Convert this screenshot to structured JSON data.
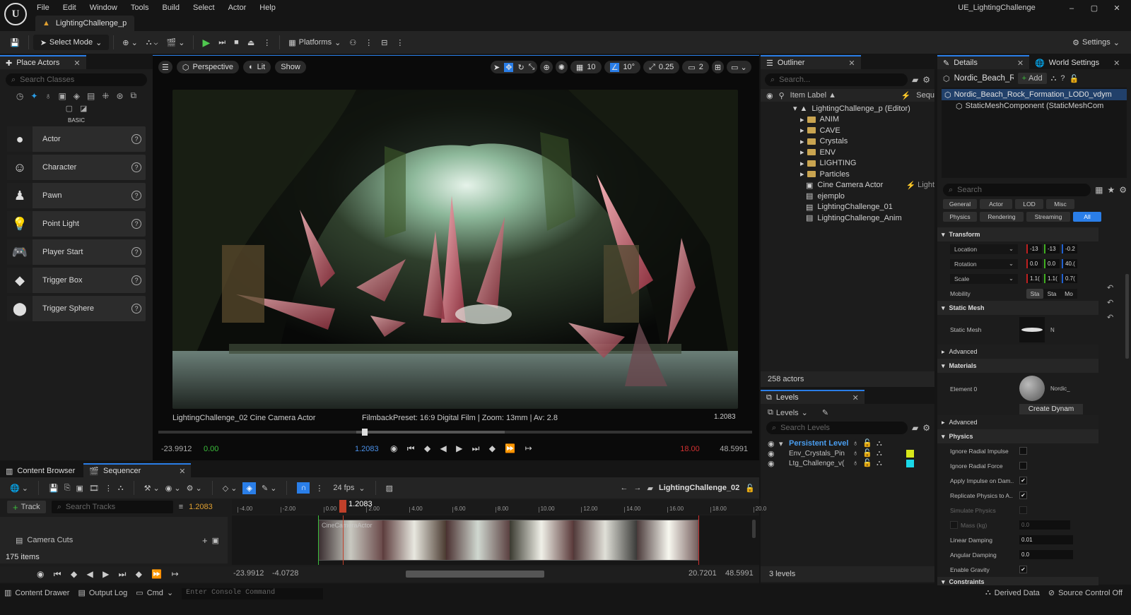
{
  "app": {
    "menus": [
      "File",
      "Edit",
      "Window",
      "Tools",
      "Build",
      "Select",
      "Actor",
      "Help"
    ],
    "level_tab": "LightingChallenge_p",
    "project_name": "UE_LightingChallenge",
    "window_controls": {
      "minimize": "–",
      "maximize": "▢",
      "close": "✕"
    }
  },
  "toolbar": {
    "select_mode": "Select Mode",
    "platforms": "Platforms",
    "settings": "Settings"
  },
  "place_actors": {
    "tab": "Place Actors",
    "search_placeholder": "Search Classes",
    "category": "BASIC",
    "items": [
      "Actor",
      "Character",
      "Pawn",
      "Point Light",
      "Player Start",
      "Trigger Box",
      "Trigger Sphere"
    ]
  },
  "viewport": {
    "perspective": "Perspective",
    "lit": "Lit",
    "show": "Show",
    "grid_snap": "10",
    "angle_snap": "10°",
    "scale_snap": "0.25",
    "camera_speed": "2",
    "camera_label": "LightingChallenge_02  Cine Camera Actor",
    "filmback": "FilmbackPreset: 16:9 Digital Film | Zoom: 13mm | Av: 2.8",
    "time_readout": "1.2083",
    "start_time": "-23.9912",
    "in_time": "0.00",
    "current_time": "1.2083",
    "out_time": "18.00",
    "end_time": "48.5991"
  },
  "outliner": {
    "tab": "Outliner",
    "search_placeholder": "Search...",
    "column_label": "Item Label ▲",
    "column_seq": "Sequ",
    "root": "LightingChallenge_p (Editor)",
    "folders": [
      "ANIM",
      "CAVE",
      "Crystals",
      "ENV",
      "LIGHTING",
      "Particles"
    ],
    "actors": [
      {
        "name": "Cine Camera Actor",
        "extra": "Light"
      },
      {
        "name": "ejemplo",
        "extra": ""
      },
      {
        "name": "LightingChallenge_01",
        "extra": ""
      },
      {
        "name": "LightingChallenge_Anim",
        "extra": ""
      }
    ],
    "count": "258 actors"
  },
  "levels": {
    "tab": "Levels",
    "dropdown": "Levels",
    "search_placeholder": "Search Levels",
    "items": [
      {
        "name": "Persistent Level",
        "color": ""
      },
      {
        "name": "Env_Crystals_Pin",
        "color": "#d8e81a"
      },
      {
        "name": "Ltg_Challenge_v(",
        "color": "#1ad8e8"
      }
    ],
    "count": "3 levels"
  },
  "details": {
    "tab": "Details",
    "world_tab": "World Settings",
    "actor_name": "Nordic_Beach_R",
    "add": "Add",
    "selected_actor": "Nordic_Beach_Rock_Formation_LOD0_vdym",
    "component": "StaticMeshComponent (StaticMeshCom",
    "search_placeholder": "Search",
    "filters_row1": [
      "General",
      "Actor",
      "LOD",
      "Misc"
    ],
    "filters_row2": [
      "Physics",
      "Rendering",
      "Streaming",
      "All"
    ],
    "transform_header": "Transform",
    "location": {
      "label": "Location",
      "values": [
        "-13",
        "-13",
        "-0.2"
      ]
    },
    "rotation": {
      "label": "Rotation",
      "values": [
        "0.0",
        "0.0",
        "40.("
      ]
    },
    "scale": {
      "label": "Scale",
      "values": [
        "1.1(",
        "1.1(",
        "0.7("
      ]
    },
    "mobility": {
      "label": "Mobility",
      "options": [
        "Sta",
        "Sta",
        "Mo"
      ]
    },
    "static_mesh_header": "Static Mesh",
    "static_mesh_label": "Static Mesh",
    "static_mesh_value": "N",
    "advanced": "Advanced",
    "materials_header": "Materials",
    "element0": "Element 0",
    "material_value": "Nordic_",
    "create_dynamic": "Create Dynam",
    "physics_header": "Physics",
    "physics_props": [
      {
        "label": "Ignore Radial Impulse",
        "checked": false
      },
      {
        "label": "Ignore Radial Force",
        "checked": false
      },
      {
        "label": "Apply Impulse on Dam..",
        "checked": true
      },
      {
        "label": "Replicate Physics to A..",
        "checked": true
      },
      {
        "label": "Simulate Physics",
        "checked": false
      }
    ],
    "mass_label": "Mass (kg)",
    "mass_value": "0.0",
    "linear_damping": {
      "label": "Linear Damping",
      "value": "0.01"
    },
    "angular_damping": {
      "label": "Angular Damping",
      "value": "0.0"
    },
    "enable_gravity": "Enable Gravity",
    "constraints": "Constraints"
  },
  "bottom": {
    "content_browser_tab": "Content Browser",
    "sequencer_tab": "Sequencer",
    "fps": "24 fps",
    "sequence_name": "LightingChallenge_02",
    "track_button": "Track",
    "search_tracks": "Search Tracks",
    "current_time": "1.2083",
    "playhead_label": "1.2083",
    "ticks": [
      "-4.00",
      "-2.00",
      "0.00",
      "2.00",
      "4.00",
      "6.00",
      "8.00",
      "10.00",
      "12.00",
      "14.00",
      "16.00",
      "18.00",
      "20.0"
    ],
    "camera_cuts": "Camera Cuts",
    "clip_label": "CineCameraActor",
    "items_count": "175 items",
    "start_time": "-23.9912",
    "in_time": "-4.0728",
    "out_time": "20.7201",
    "end_time": "48.5991"
  },
  "statusbar": {
    "content_drawer": "Content Drawer",
    "output_log": "Output Log",
    "cmd": "Cmd",
    "console_placeholder": "Enter Console Command",
    "derived_data": "Derived Data",
    "source_control": "Source Control Off"
  }
}
